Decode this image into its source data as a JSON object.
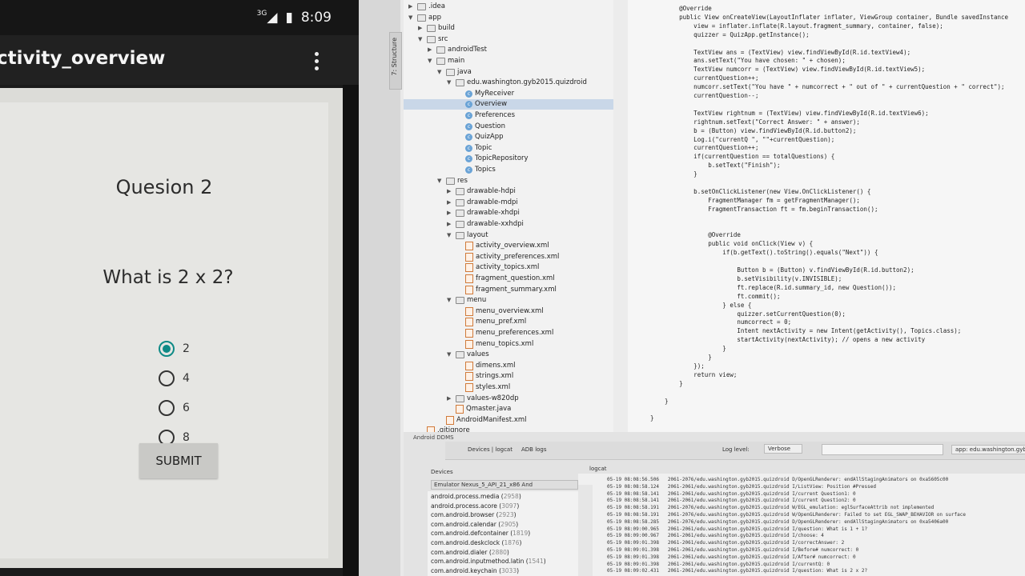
{
  "status_bar": {
    "signal": "3G",
    "time": "8:09"
  },
  "app_bar": {
    "title": "ctivity_overview"
  },
  "quiz": {
    "question_number": "Quesion 2",
    "question_text": "What is 2 x 2?",
    "options": [
      {
        "label": "2",
        "selected": true
      },
      {
        "label": "4",
        "selected": false
      },
      {
        "label": "6",
        "selected": false
      },
      {
        "label": "8",
        "selected": false
      }
    ],
    "submit_label": "SUBMIT"
  },
  "accent_color": "#0e8a86",
  "ide": {
    "structure_tab": "7: Structure",
    "tree": [
      {
        "text": ".idea",
        "kind": "folder",
        "depth": 0,
        "open": false
      },
      {
        "text": "app",
        "kind": "folder",
        "depth": 0,
        "open": true
      },
      {
        "text": "build",
        "kind": "folder",
        "depth": 1,
        "open": false
      },
      {
        "text": "src",
        "kind": "folder",
        "depth": 1,
        "open": true
      },
      {
        "text": "androidTest",
        "kind": "folder",
        "depth": 2,
        "open": false
      },
      {
        "text": "main",
        "kind": "folder",
        "depth": 2,
        "open": true
      },
      {
        "text": "java",
        "kind": "folder",
        "depth": 3,
        "open": true
      },
      {
        "text": "edu.washington.gyb2015.quizdroid",
        "kind": "folder",
        "depth": 4,
        "open": true
      },
      {
        "text": "MyReceiver",
        "kind": "class",
        "depth": 5
      },
      {
        "text": "Overview",
        "kind": "class",
        "depth": 5,
        "selected": true
      },
      {
        "text": "Preferences",
        "kind": "class",
        "depth": 5
      },
      {
        "text": "Question",
        "kind": "class",
        "depth": 5
      },
      {
        "text": "QuizApp",
        "kind": "class",
        "depth": 5
      },
      {
        "text": "Topic",
        "kind": "class",
        "depth": 5
      },
      {
        "text": "TopicRepository",
        "kind": "class",
        "depth": 5
      },
      {
        "text": "Topics",
        "kind": "class",
        "depth": 5
      },
      {
        "text": "res",
        "kind": "folder",
        "depth": 3,
        "open": true
      },
      {
        "text": "drawable-hdpi",
        "kind": "folder",
        "depth": 4,
        "open": false
      },
      {
        "text": "drawable-mdpi",
        "kind": "folder",
        "depth": 4,
        "open": false
      },
      {
        "text": "drawable-xhdpi",
        "kind": "folder",
        "depth": 4,
        "open": false
      },
      {
        "text": "drawable-xxhdpi",
        "kind": "folder",
        "depth": 4,
        "open": false
      },
      {
        "text": "layout",
        "kind": "folder",
        "depth": 4,
        "open": true
      },
      {
        "text": "activity_overview.xml",
        "kind": "xml",
        "depth": 5
      },
      {
        "text": "activity_preferences.xml",
        "kind": "xml",
        "depth": 5
      },
      {
        "text": "activity_topics.xml",
        "kind": "xml",
        "depth": 5
      },
      {
        "text": "fragment_question.xml",
        "kind": "xml",
        "depth": 5
      },
      {
        "text": "fragment_summary.xml",
        "kind": "xml",
        "depth": 5
      },
      {
        "text": "menu",
        "kind": "folder",
        "depth": 4,
        "open": true
      },
      {
        "text": "menu_overview.xml",
        "kind": "xml",
        "depth": 5
      },
      {
        "text": "menu_pref.xml",
        "kind": "xml",
        "depth": 5
      },
      {
        "text": "menu_preferences.xml",
        "kind": "xml",
        "depth": 5
      },
      {
        "text": "menu_topics.xml",
        "kind": "xml",
        "depth": 5
      },
      {
        "text": "values",
        "kind": "folder",
        "depth": 4,
        "open": true
      },
      {
        "text": "dimens.xml",
        "kind": "xml",
        "depth": 5
      },
      {
        "text": "strings.xml",
        "kind": "xml",
        "depth": 5
      },
      {
        "text": "styles.xml",
        "kind": "xml",
        "depth": 5
      },
      {
        "text": "values-w820dp",
        "kind": "folder",
        "depth": 4,
        "open": false
      },
      {
        "text": "Qmaster.java",
        "kind": "xml",
        "depth": 4
      },
      {
        "text": "AndroidManifest.xml",
        "kind": "xml",
        "depth": 3
      },
      {
        "text": ".gitignore",
        "kind": "file",
        "depth": 1
      },
      {
        "text": "app.iml",
        "kind": "file",
        "depth": 1
      }
    ],
    "code": [
      "        @Override",
      "        public View onCreateView(LayoutInflater inflater, ViewGroup container, Bundle savedInstance",
      "            view = inflater.inflate(R.layout.fragment_summary, container, false);",
      "            quizzer = QuizApp.getInstance();",
      "",
      "            TextView ans = (TextView) view.findViewById(R.id.textView4);",
      "            ans.setText(\"You have chosen: \" + chosen);",
      "            TextView numcorr = (TextView) view.findViewById(R.id.textView5);",
      "            currentQuestion++;",
      "            numcorr.setText(\"You have \" + numcorrect + \" out of \" + currentQuestion + \" correct\");",
      "            currentQuestion--;",
      "",
      "            TextView rightnum = (TextView) view.findViewById(R.id.textView6);",
      "            rightnum.setText(\"Correct Answer: \" + answer);",
      "            b = (Button) view.findViewById(R.id.button2);",
      "            Log.i(\"currentQ \", \"\"+currentQuestion);",
      "            currentQuestion++;",
      "            if(currentQuestion == totalQuestions) {",
      "                b.setText(\"Finish\");",
      "            }",
      "",
      "            b.setOnClickListener(new View.OnClickListener() {",
      "                FragmentManager fm = getFragmentManager();",
      "                FragmentTransaction ft = fm.beginTransaction();",
      "",
      "",
      "                @Override",
      "                public void onClick(View v) {",
      "                    if(b.getText().toString().equals(\"Next\")) {",
      "",
      "                        Button b = (Button) v.findViewById(R.id.button2);",
      "                        b.setVisibility(v.INVISIBLE);",
      "                        ft.replace(R.id.summary_id, new Question());",
      "                        ft.commit();",
      "                    } else {",
      "                        quizzer.setCurrentQuestion(0);",
      "                        numcorrect = 0;",
      "                        Intent nextActivity = new Intent(getActivity(), Topics.class);",
      "                        startActivity(nextActivity); // opens a new activity",
      "                    }",
      "                }",
      "            });",
      "            return view;",
      "        }",
      "",
      "    }",
      "",
      "}"
    ],
    "ddms": {
      "title": "Android DDMS",
      "tabs": [
        "Devices | logcat",
        "ADB logs"
      ],
      "log_level_label": "Log level:",
      "log_level_value": "Verbose",
      "package_filter": "app: edu.washington.gyb2015.quizd",
      "devices_header": "Devices",
      "logcat_header": "logcat",
      "device": "Emulator Nexus_5_API_21_x86 And",
      "processes": [
        {
          "name": "android.process.media",
          "pid": "2958"
        },
        {
          "name": "android.process.acore",
          "pid": "3097"
        },
        {
          "name": "com.android.browser",
          "pid": "2923"
        },
        {
          "name": "com.android.calendar",
          "pid": "2905"
        },
        {
          "name": "com.android.defcontainer",
          "pid": "1819"
        },
        {
          "name": "com.android.deskclock",
          "pid": "1876"
        },
        {
          "name": "com.android.dialer",
          "pid": "2880"
        },
        {
          "name": "com.android.inputmethod.latin",
          "pid": "1541"
        },
        {
          "name": "com.android.keychain",
          "pid": "3033"
        }
      ],
      "log_lines": [
        "05-19 08:08:56.506   2061-2076/edu.washington.gyb2015.quizdroid D/OpenGLRenderer: endAllStagingAnimators on 0xa5605c00",
        "05-19 08:08:58.124   2061-2061/edu.washington.gyb2015.quizdroid I/ListView: Position #Pressed",
        "05-19 08:08:58.141   2061-2061/edu.washington.gyb2015.quizdroid I/current Question1: 0",
        "05-19 08:08:58.141   2061-2061/edu.washington.gyb2015.quizdroid I/current Question2: 0",
        "05-19 08:08:58.191   2061-2076/edu.washington.gyb2015.quizdroid W/EGL_emulation: eglSurfaceAttrib not implemented",
        "05-19 08:08:58.191   2061-2076/edu.washington.gyb2015.quizdroid W/OpenGLRenderer: Failed to set EGL_SWAP_BEHAVIOR on surface",
        "05-19 08:08:58.285   2061-2076/edu.washington.gyb2015.quizdroid D/OpenGLRenderer: endAllStagingAnimators on 0xa5406a00",
        "05-19 08:09:00.965   2061-2061/edu.washington.gyb2015.quizdroid I/question: What is 1 + 1?",
        "05-19 08:09:00.967   2061-2061/edu.washington.gyb2015.quizdroid I/choose: 4",
        "05-19 08:09:01.398   2061-2061/edu.washington.gyb2015.quizdroid I/correctAnswer: 2",
        "05-19 08:09:01.398   2061-2061/edu.washington.gyb2015.quizdroid I/Before# numcorrect: 0",
        "05-19 08:09:01.398   2061-2061/edu.washington.gyb2015.quizdroid I/After# numcorrect: 0",
        "05-19 08:09:01.398   2061-2061/edu.washington.gyb2015.quizdroid I/currentQ: 0",
        "05-19 08:09:02.431   2061-2061/edu.washington.gyb2015.quizdroid I/question: What is 2 x 2?"
      ]
    }
  }
}
